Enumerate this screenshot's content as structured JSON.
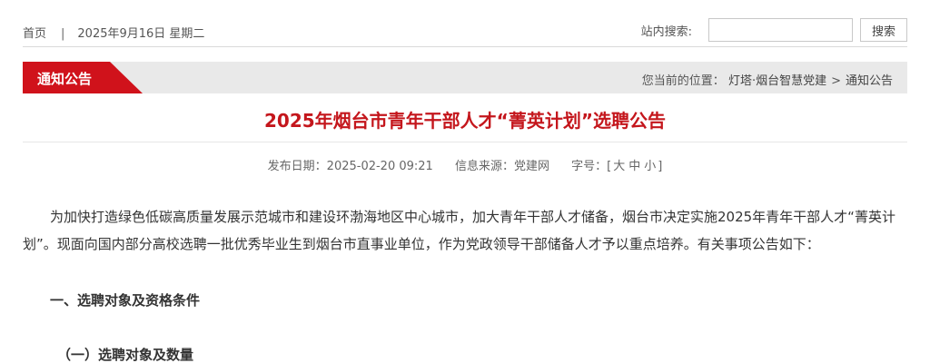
{
  "topbar": {
    "home_link": "首页",
    "separator": "|",
    "date": "2025年9月16日 星期二",
    "search_label": "站内搜索:",
    "search_value": "",
    "search_button": "搜索"
  },
  "column_bar": {
    "tab_label": "通知公告",
    "breadcrumb_prefix": "您当前的位置：",
    "breadcrumb": [
      "灯塔·烟台智慧党建",
      "通知公告"
    ],
    "breadcrumb_separator": ">"
  },
  "article": {
    "title": "2025年烟台市青年干部人才“菁英计划”选聘公告",
    "publish_label": "发布日期：",
    "publish_date": "2025-02-20 09:21",
    "source_label": "信息来源：",
    "source": "党建网",
    "font_size_label": "字号：[",
    "font_sizes": [
      "大",
      "中",
      "小"
    ],
    "font_size_close": "]",
    "paragraph1": "为加快打造绿色低碳高质量发展示范城市和建设环渤海地区中心城市，加大青年干部人才储备，烟台市决定实施2025年青年干部人才“菁英计划”。现面向国内部分高校选聘一批优秀毕业生到烟台市直事业单位，作为党政领导干部储备人才予以重点培养。有关事项公告如下：",
    "heading1": "一、选聘对象及资格条件",
    "heading2": "（一）选聘对象及数量"
  },
  "colors": {
    "accent_red": "#c4161c",
    "tab_red": "#d0121b",
    "bar_gray": "#e9e9e9"
  }
}
